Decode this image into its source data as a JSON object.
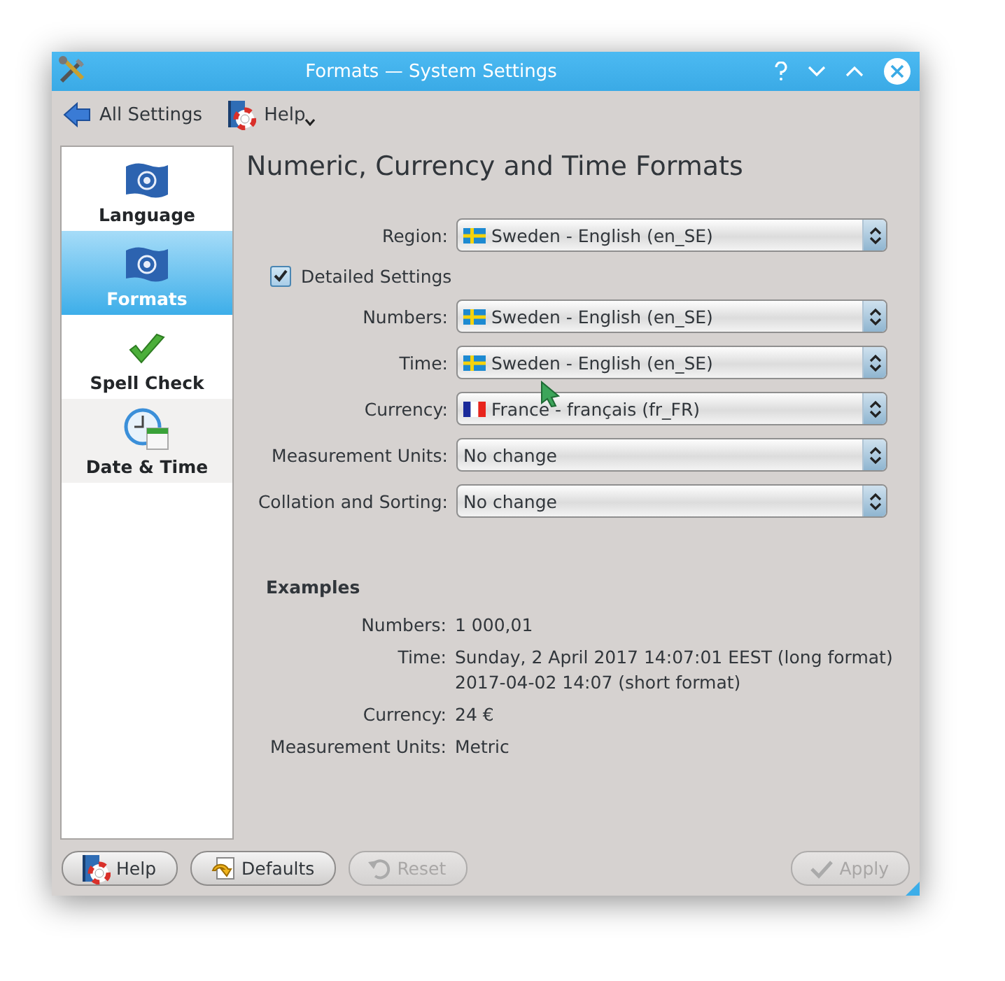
{
  "window": {
    "title": "Formats — System Settings"
  },
  "toolbar": [
    {
      "kind": "back",
      "label": "All Settings"
    },
    {
      "kind": "help-menu",
      "label": "Help"
    }
  ],
  "sidebar": {
    "items": [
      {
        "kind": "language",
        "label": "Language",
        "selected": false,
        "hovered": false
      },
      {
        "kind": "formats",
        "label": "Formats",
        "selected": true,
        "hovered": false
      },
      {
        "kind": "spell",
        "label": "Spell Check",
        "selected": false,
        "hovered": false
      },
      {
        "kind": "datetime",
        "label": "Date & Time",
        "selected": false,
        "hovered": true
      }
    ]
  },
  "heading": "Numeric, Currency and Time Formats",
  "form": {
    "rows": [
      {
        "kind": "sweden",
        "label": "Region:",
        "value": "Sweden - English (en_SE)"
      },
      {
        "kind": "checkbox",
        "label": "Detailed Settings",
        "checked": true
      },
      {
        "kind": "sweden",
        "label": "Numbers:",
        "value": "Sweden - English (en_SE)"
      },
      {
        "kind": "sweden",
        "label": "Time:",
        "value": "Sweden - English (en_SE)"
      },
      {
        "kind": "france",
        "label": "Currency:",
        "value": "France - français (fr_FR)"
      },
      {
        "kind": "plain",
        "label": "Measurement Units:",
        "value": "No change"
      },
      {
        "kind": "plain",
        "label": "Collation and Sorting:",
        "value": "No change"
      }
    ]
  },
  "examples": {
    "title": "Examples",
    "rows": [
      {
        "label": "Numbers:",
        "lines": [
          "1 000,01"
        ]
      },
      {
        "label": "Time:",
        "lines": [
          "Sunday, 2 April 2017 14:07:01 EEST (long format)",
          "2017-04-02 14:07 (short format)"
        ]
      },
      {
        "label": "Currency:",
        "lines": [
          "24 €"
        ]
      },
      {
        "label": "Measurement Units:",
        "lines": [
          "Metric"
        ]
      }
    ]
  },
  "buttons": [
    {
      "kind": "help",
      "label": "Help",
      "disabled": false
    },
    {
      "kind": "defaults",
      "label": "Defaults",
      "disabled": false
    },
    {
      "kind": "reset",
      "label": "Reset",
      "disabled": true
    },
    {
      "kind": "apply",
      "label": "Apply",
      "disabled": true
    }
  ]
}
